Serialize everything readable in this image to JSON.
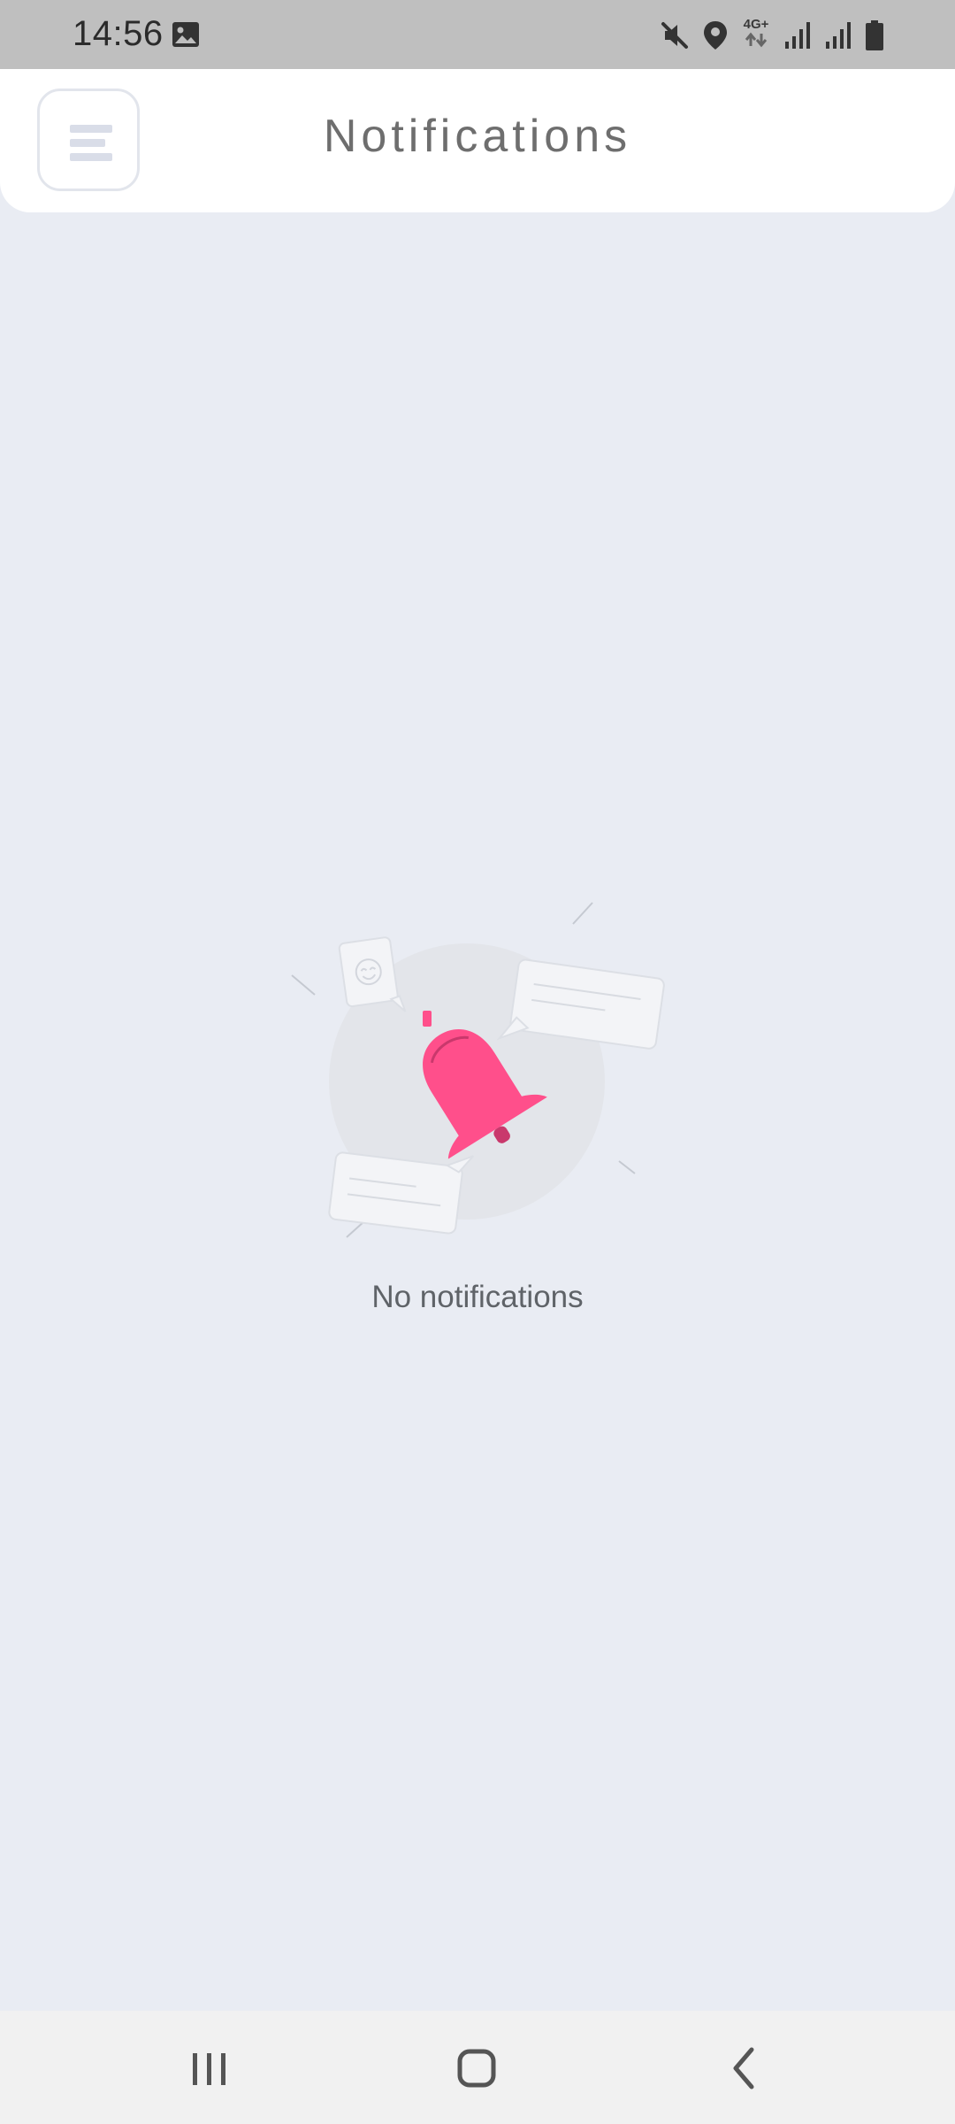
{
  "status_bar": {
    "time": "14:56",
    "network": "4G+",
    "icons": [
      "gallery-icon",
      "mute-icon",
      "location-icon",
      "signal-icon",
      "signal-icon",
      "battery-icon"
    ]
  },
  "header": {
    "title": "Notifications",
    "menu_icon": "menu-icon"
  },
  "empty_state": {
    "illustration": "bell-icon",
    "message": "No notifications",
    "accent_color": "#ff4f8b"
  },
  "nav_bar": {
    "buttons": [
      "recents-icon",
      "home-icon",
      "back-icon"
    ]
  },
  "colors": {
    "background": "#e9ecf3",
    "header": "#ffffff",
    "status_bar": "#bfbfbf",
    "title_text": "#6e6e6e",
    "accent": "#ff4f8b"
  }
}
